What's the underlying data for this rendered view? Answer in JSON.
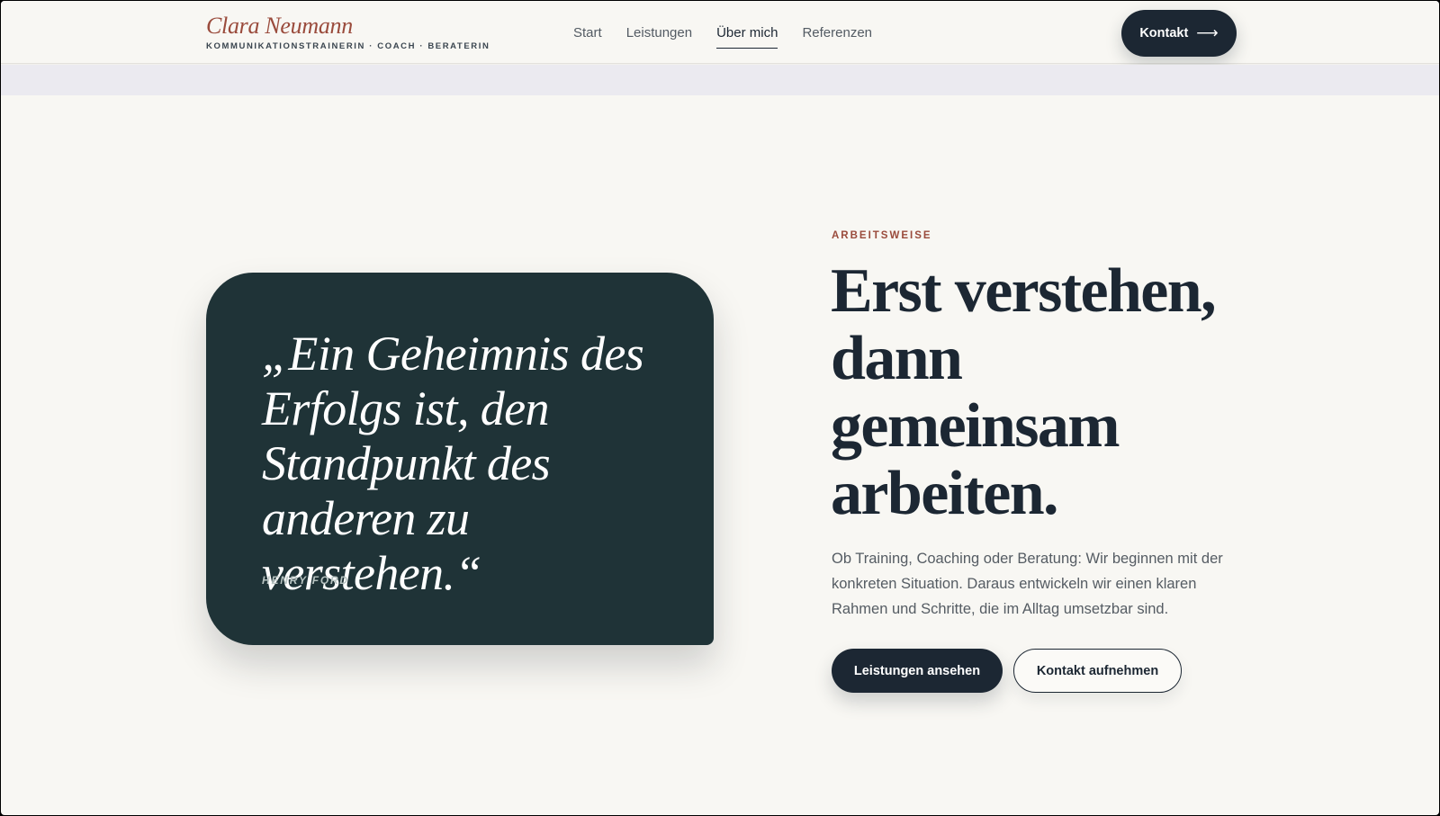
{
  "brand": {
    "name": "Clara Neumann",
    "tagline": "KOMMUNIKATIONSTRAINERIN · COACH · BERATERIN",
    "accent_color": "#9a4b3c"
  },
  "nav": {
    "items": [
      {
        "label": "Start",
        "active": false
      },
      {
        "label": "Leistungen",
        "active": false
      },
      {
        "label": "Über mich",
        "active": true
      },
      {
        "label": "Referenzen",
        "active": false
      }
    ]
  },
  "header_cta": {
    "label": "Kontakt",
    "icon": "arrow-right-icon",
    "glyph": "⟶"
  },
  "quote": {
    "text": "„Ein Geheimnis des Erfolgs ist, den Standpunkt des anderen zu verstehen.“",
    "author": "HENRY FORD",
    "card_color": "#1f3337"
  },
  "section": {
    "eyebrow": "ARBEITSWEISE",
    "headline": "Erst verstehen, dann gemeinsam arbeiten.",
    "lead": "Ob Training, Coaching oder Beratung: Wir beginnen mit der konkreten Situation. Daraus entwickeln wir einen klaren Rahmen und Schritte, die im Alltag umsetzbar sind.",
    "primary_button": "Leistungen ansehen",
    "secondary_button": "Kontakt aufnehmen"
  },
  "colors": {
    "background": "#f8f7f3",
    "ink": "#1c2733"
  }
}
